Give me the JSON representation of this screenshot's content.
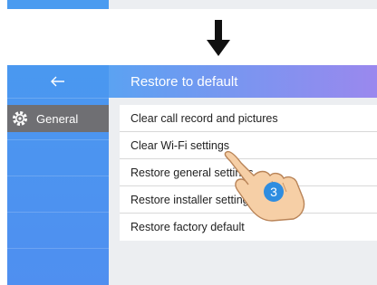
{
  "header": {
    "title": "Restore to default"
  },
  "sidebar": {
    "back_icon": "back-arrow-icon",
    "items": [
      {
        "label": "General",
        "icon": "gear-icon",
        "selected": true
      }
    ]
  },
  "list": {
    "items": [
      {
        "label": "Clear call record and pictures"
      },
      {
        "label": "Clear Wi-Fi settings"
      },
      {
        "label": "Restore general settings"
      },
      {
        "label": "Restore installer settings"
      },
      {
        "label": "Restore factory default"
      }
    ]
  },
  "annotation": {
    "step_number": "3"
  },
  "colors": {
    "sidebar": "#4a98f0",
    "header_start": "#5ba2f2",
    "header_end": "#9a88ee",
    "selected_item": "#6f6f73",
    "step_badge": "#2f8de0"
  }
}
